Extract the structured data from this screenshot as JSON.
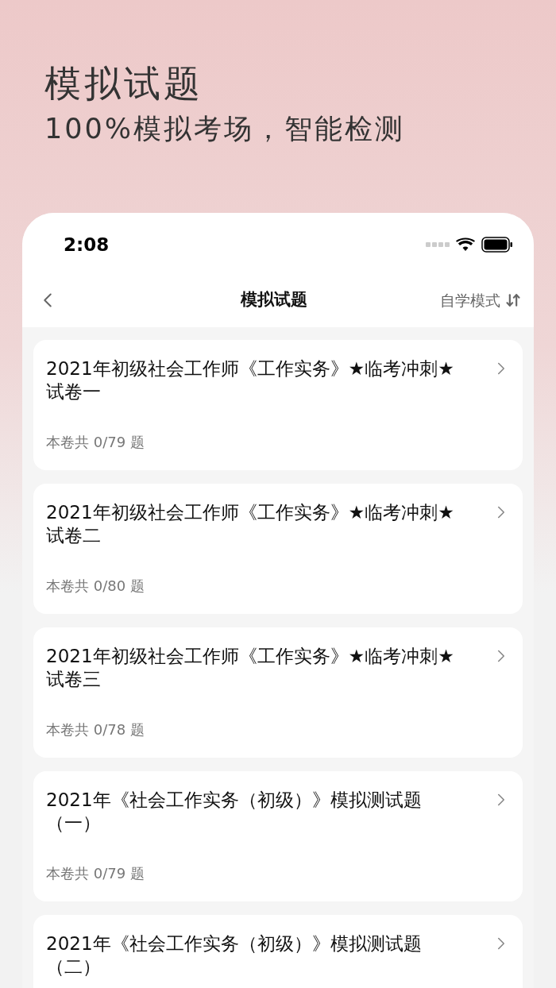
{
  "promo": {
    "title": "模拟试题",
    "subtitle": "100%模拟考场，智能检测"
  },
  "status_bar": {
    "time": "2:08"
  },
  "nav": {
    "title": "模拟试题",
    "mode": "自学模式"
  },
  "papers": [
    {
      "title": "2021年初级社会工作师《工作实务》★临考冲刺★试卷一",
      "count": "本卷共 0/79 题"
    },
    {
      "title": "2021年初级社会工作师《工作实务》★临考冲刺★试卷二",
      "count": "本卷共 0/80 题"
    },
    {
      "title": "2021年初级社会工作师《工作实务》★临考冲刺★试卷三",
      "count": "本卷共 0/78 题"
    },
    {
      "title": "2021年《社会工作实务（初级）》模拟测试题（一）",
      "count": "本卷共 0/79 题"
    },
    {
      "title": "2021年《社会工作实务（初级）》模拟测试题（二）"
    }
  ]
}
